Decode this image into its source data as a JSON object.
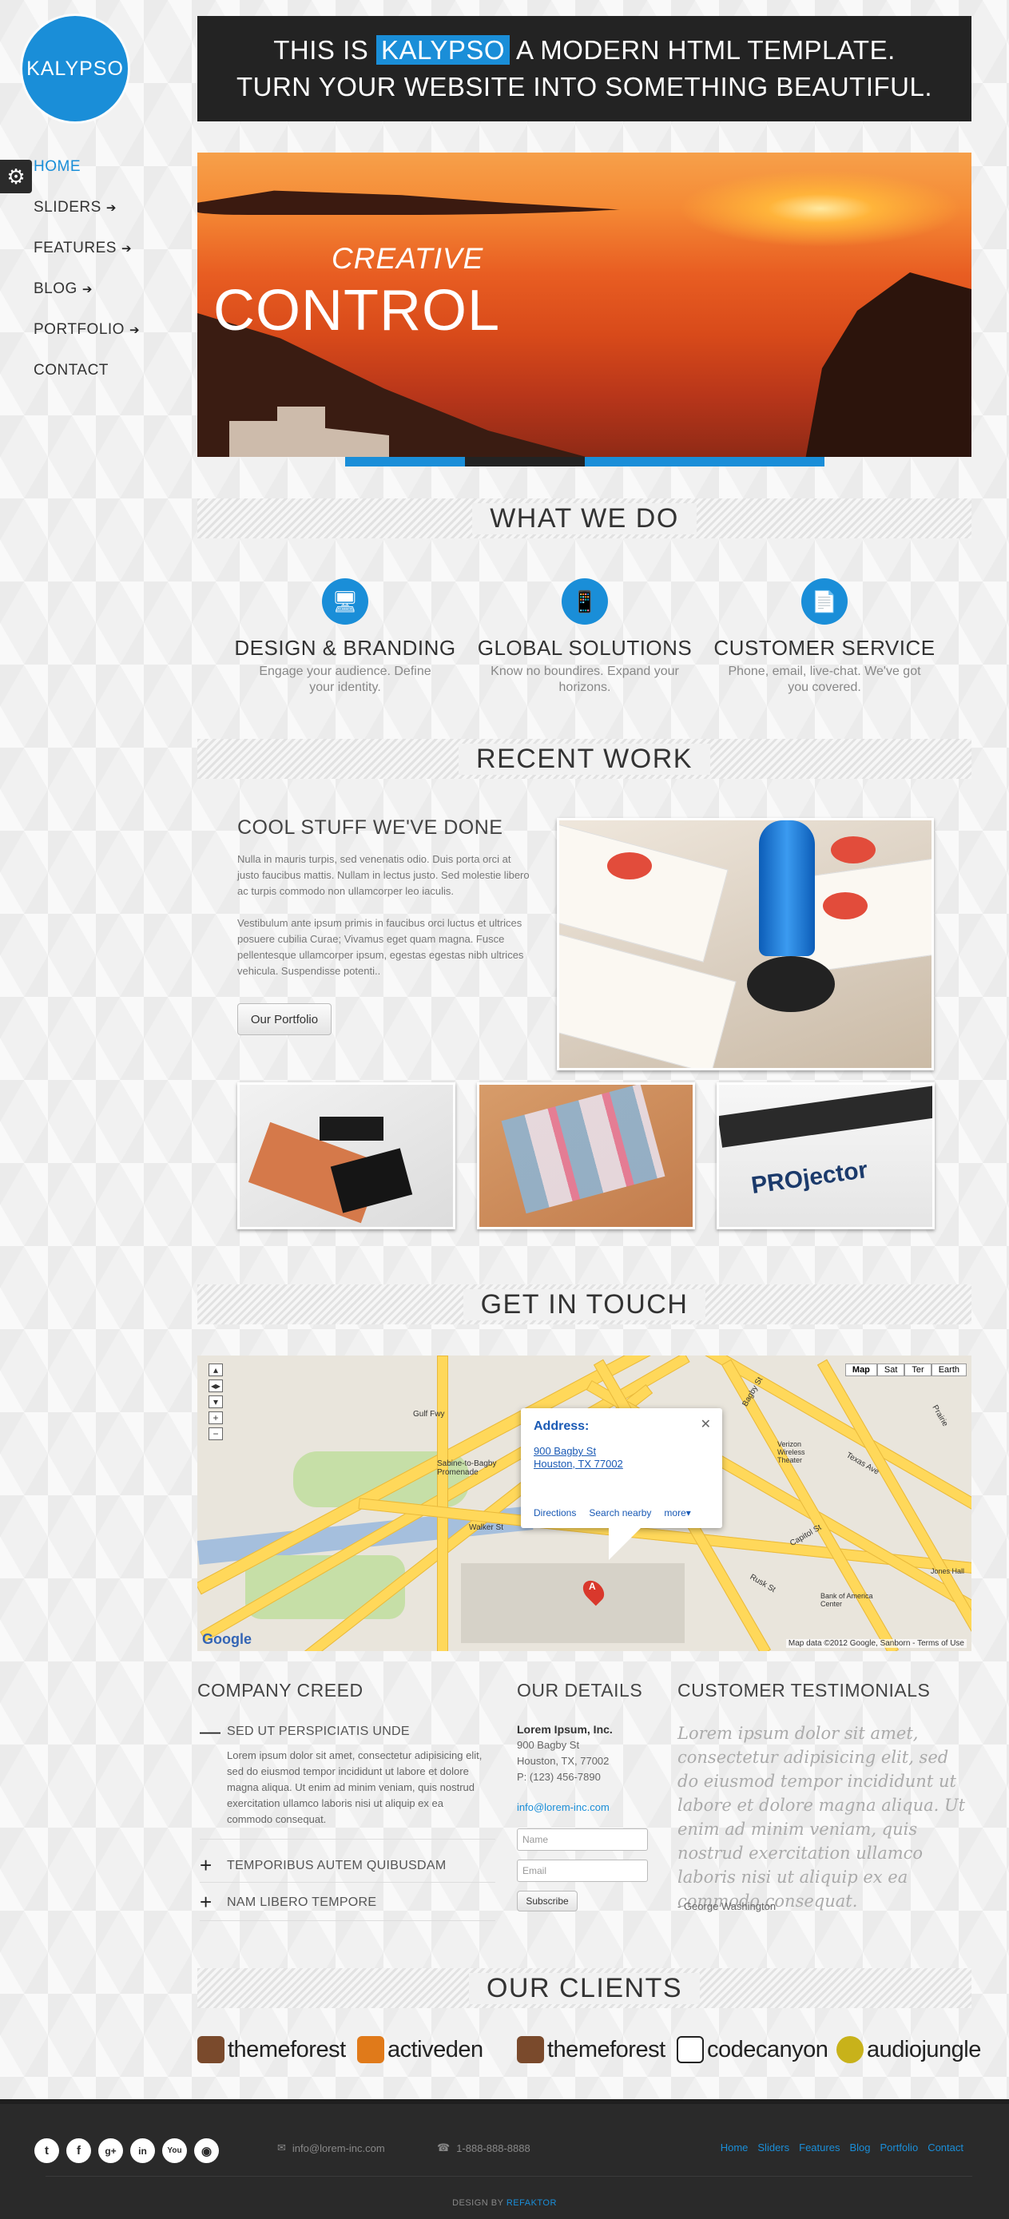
{
  "brand": {
    "logo": "KALYPSO",
    "accent": "#1a8ed8"
  },
  "nav": {
    "items": [
      {
        "label": "HOME",
        "active": true,
        "arrow": ""
      },
      {
        "label": "SLIDERS",
        "active": false,
        "arrow": "➔"
      },
      {
        "label": "FEATURES",
        "active": false,
        "arrow": "➔"
      },
      {
        "label": "BLOG",
        "active": false,
        "arrow": "➔"
      },
      {
        "label": "PORTFOLIO",
        "active": false,
        "arrow": "➔"
      },
      {
        "label": "CONTACT",
        "active": false,
        "arrow": ""
      }
    ]
  },
  "banner": {
    "pre": "THIS IS",
    "highlight": "KALYPSO",
    "post": "A MODERN HTML TEMPLATE.",
    "line2": "TURN YOUR WEBSITE INTO SOMETHING BEAUTIFUL."
  },
  "slider": {
    "caption_top": "CREATIVE",
    "caption_main": "CONTROL",
    "tabs": 4,
    "active_tab": 2
  },
  "what_we_do": {
    "heading": "WHAT WE DO",
    "services": [
      {
        "icon": "monitor-icon",
        "glyph": "🖥",
        "title": "DESIGN & BRANDING",
        "text": "Engage your audience. Define your identity."
      },
      {
        "icon": "mobile-icon",
        "glyph": "📱",
        "title": "GLOBAL SOLUTIONS",
        "text": "Know no boundires. Expand your horizons."
      },
      {
        "icon": "document-icon",
        "glyph": "📄",
        "title": "CUSTOMER SERVICE",
        "text": "Phone, email, live-chat. We've got you covered."
      }
    ]
  },
  "recent_work": {
    "heading": "RECENT WORK",
    "title": "COOL STUFF WE'VE DONE",
    "para1": "Nulla in mauris turpis, sed venenatis odio. Duis porta orci at justo faucibus mattis. Nullam in lectus justo. Sed molestie libero ac turpis commodo non ullamcorper leo iaculis.",
    "para2": "Vestibulum ante ipsum primis in faucibus orci luctus et ultrices posuere cubilia Curae; Vivamus eget quam magna. Fusce pellentesque ullamcorper ipsum, egestas egestas nibh ultrices vehicula. Suspendisse potenti..",
    "button": "Our Portfolio",
    "thumb3_text": "PROjector"
  },
  "get_in_touch": {
    "heading": "GET IN TOUCH",
    "map": {
      "types": [
        "Map",
        "Sat",
        "Ter",
        "Earth"
      ],
      "info_title": "Address:",
      "info_line1": "900 Bagby St",
      "info_line2": "Houston, TX 77002",
      "links": [
        "Directions",
        "Search nearby",
        "more▾"
      ],
      "marker": "A",
      "attribution": "Map data ©2012 Google, Sanborn - Terms of Use",
      "google": "Google",
      "labels": [
        "Gulf Fwy",
        "Sabine-to-Bagby Promenade",
        "Walker St",
        "Bagby St",
        "Texas Ave",
        "Capitol St",
        "Rusk St",
        "Prairie",
        "Jones Hall",
        "Bank of America Center",
        "Verizon Wireless Theater"
      ]
    }
  },
  "creed": {
    "heading": "COMPANY CREED",
    "items": [
      {
        "sym": "—",
        "title": "SED UT PERSPICIATIS UNDE",
        "open": true,
        "body": "Lorem ipsum dolor sit amet, consectetur adipisicing elit, sed do eiusmod tempor incididunt ut labore et dolore magna aliqua. Ut enim ad minim veniam, quis nostrud exercitation ullamco laboris nisi ut aliquip ex ea commodo consequat."
      },
      {
        "sym": "+",
        "title": "TEMPORIBUS AUTEM QUIBUSDAM",
        "open": false,
        "body": ""
      },
      {
        "sym": "+",
        "title": "NAM LIBERO TEMPORE",
        "open": false,
        "body": ""
      }
    ]
  },
  "details": {
    "heading": "OUR DETAILS",
    "company": "Lorem Ipsum, Inc.",
    "street": "900 Bagby St",
    "city": "Houston, TX, 77002",
    "phone": "P: (123) 456-7890",
    "email": "info@lorem-inc.com",
    "name_placeholder": "Name",
    "email_placeholder": "Email",
    "subscribe": "Subscribe"
  },
  "testimonials": {
    "heading": "CUSTOMER TESTIMONIALS",
    "quote": "Lorem ipsum dolor sit amet, consectetur adipisicing elit, sed do eiusmod tempor incididunt ut labore et dolore magna aliqua. Ut enim ad minim veniam, quis nostrud exercitation ullamco laboris nisi ut aliquip ex ea commodo consequat.",
    "author": "- George Washington"
  },
  "clients": {
    "heading": "OUR CLIENTS",
    "items": [
      {
        "name": "themeforest",
        "color": "#7a4a2c"
      },
      {
        "name": "activeden",
        "color": "#e07a1a"
      },
      {
        "name": "themeforest",
        "color": "#7a4a2c"
      },
      {
        "name": "codecanyon",
        "color": "#ffffff"
      },
      {
        "name": "audiojungle",
        "color": "#c8b21a"
      }
    ]
  },
  "footer": {
    "social": [
      {
        "icon": "twitter-icon",
        "glyph": "t"
      },
      {
        "icon": "facebook-icon",
        "glyph": "f"
      },
      {
        "icon": "googleplus-icon",
        "glyph": "g+"
      },
      {
        "icon": "linkedin-icon",
        "glyph": "in"
      },
      {
        "icon": "youtube-icon",
        "glyph": "You"
      },
      {
        "icon": "rss-icon",
        "glyph": "◉"
      }
    ],
    "email": "info@lorem-inc.com",
    "phone": "1-888-888-8888",
    "links": [
      "Home",
      "Sliders",
      "Features",
      "Blog",
      "Portfolio",
      "Contact"
    ],
    "credit_pre": "DESIGN BY",
    "credit_name": "REFAKTOR"
  }
}
